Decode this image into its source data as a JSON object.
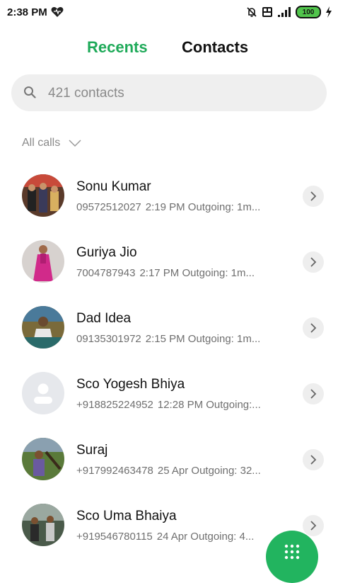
{
  "status_bar": {
    "time": "2:38 PM",
    "battery": "100",
    "icons": [
      "heart-icon",
      "alarm-off-icon",
      "volte-icon",
      "signal-icon",
      "battery-icon",
      "charging-icon"
    ]
  },
  "tabs": {
    "recents": "Recents",
    "contacts": "Contacts",
    "active": "recents",
    "active_color": "#1faa59"
  },
  "search": {
    "placeholder": "421 contacts"
  },
  "filter": {
    "label": "All calls"
  },
  "calls": [
    {
      "name": "Sonu Kumar",
      "number": "09572512027",
      "detail": "2:19 PM Outgoing: 1m..."
    },
    {
      "name": "Guriya Jio",
      "number": "7004787943",
      "detail": "2:17 PM Outgoing: 1m..."
    },
    {
      "name": "Dad Idea",
      "number": "09135301972",
      "detail": "2:15 PM Outgoing: 1m..."
    },
    {
      "name": "Sco Yogesh Bhiya",
      "number": "+918825224952",
      "detail": "12:28 PM Outgoing:..."
    },
    {
      "name": "Suraj",
      "number": "+917992463478",
      "detail": "25 Apr Outgoing: 32..."
    },
    {
      "name": "Sco Uma Bhaiya",
      "number": "+919546780115",
      "detail": "24 Apr Outgoing: 4..."
    }
  ],
  "fab": {
    "icon": "dialpad-icon",
    "color": "#22b45f"
  }
}
